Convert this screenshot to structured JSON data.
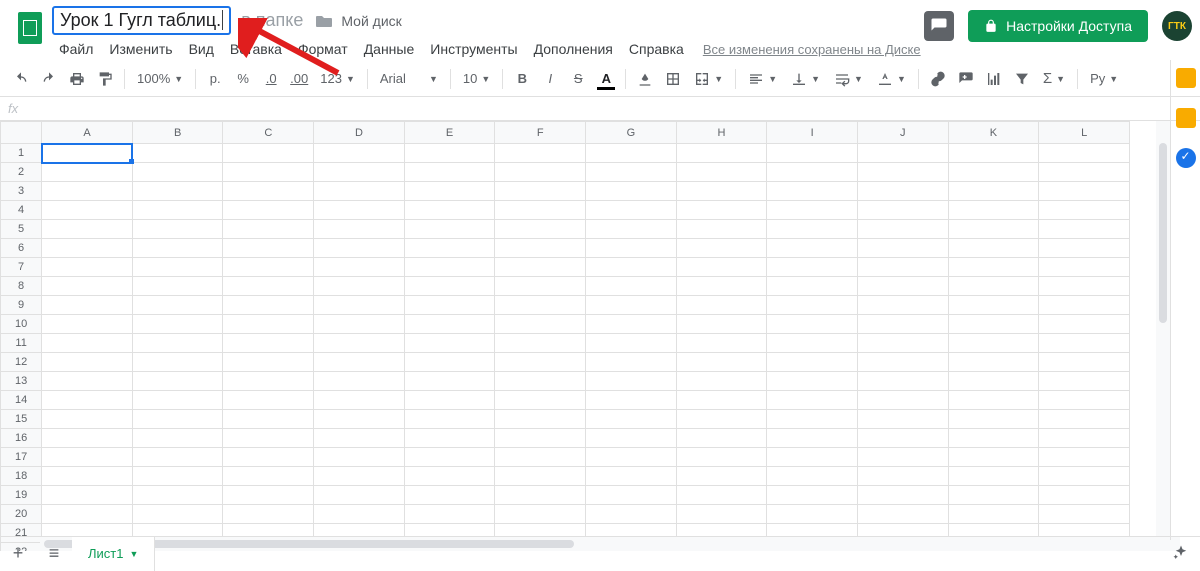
{
  "header": {
    "doc_name": "Урок 1 Гугл таблиц.",
    "folder_prefix": "в папке",
    "folder_name": "Мой диск",
    "autosave": "Все изменения сохранены на Диске",
    "share_label": "Настройки Доступа",
    "avatar_text": "ГТК"
  },
  "menu": {
    "items": [
      "Файл",
      "Изменить",
      "Вид",
      "Вставка",
      "Формат",
      "Данные",
      "Инструменты",
      "Дополнения",
      "Справка"
    ]
  },
  "toolbar": {
    "zoom": "100%",
    "currency_symbol": "p.",
    "percent": "%",
    "dec_dec": ".0",
    "dec_inc": ".00",
    "format_123": "123",
    "font": "Arial",
    "font_size": "10",
    "script_label": "Ру"
  },
  "formula_bar": {
    "label": "fx",
    "value": ""
  },
  "grid": {
    "columns": [
      "A",
      "B",
      "C",
      "D",
      "E",
      "F",
      "G",
      "H",
      "I",
      "J",
      "K",
      "L"
    ],
    "row_count": 22,
    "selected_cell": "A1"
  },
  "sheet_tabs": {
    "active": "Лист1"
  }
}
